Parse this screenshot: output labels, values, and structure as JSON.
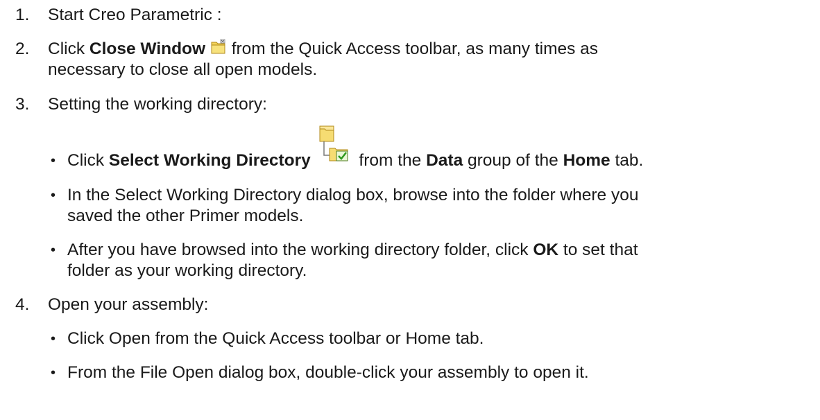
{
  "steps": [
    {
      "number": "1.",
      "text": "Start Creo Parametric :"
    },
    {
      "number": "2.",
      "pre": "Click ",
      "bold": "Close Window",
      "icon": "close-window-folder-icon",
      "post": " from the Quick Access toolbar, as many times as",
      "line2": "necessary to close all open models."
    },
    {
      "number": "3.",
      "text": "Setting the working directory:",
      "bullets": [
        {
          "pre": "Click ",
          "bold": "Select Working Directory",
          "icon": "select-working-directory-icon",
          "mid1": " from the ",
          "bold2": "Data",
          "mid2": " group of the ",
          "bold3": "Home",
          "post": " tab."
        },
        {
          "line1": "In the Select Working Directory dialog box, browse into the folder where you",
          "line2": "saved the other Primer models."
        },
        {
          "pre": "After you have browsed into the working directory folder, click ",
          "bold": "OK",
          "post": " to set that",
          "line2": "folder as your working directory."
        }
      ]
    },
    {
      "number": "4.",
      "text": "Open your assembly:",
      "bullets": [
        {
          "text": "Click Open from the Quick Access toolbar or Home tab."
        },
        {
          "text": "From the File Open dialog box, double-click your assembly to open it."
        }
      ]
    }
  ],
  "bullet_char": "•"
}
